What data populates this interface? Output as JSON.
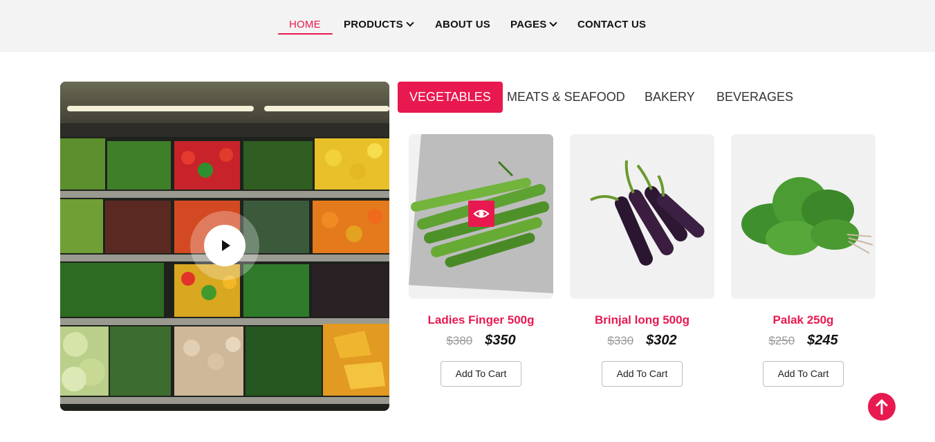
{
  "nav": {
    "items": [
      {
        "label": "HOME",
        "active": true
      },
      {
        "label": "PRODUCTS",
        "dropdown": true
      },
      {
        "label": "ABOUT US"
      },
      {
        "label": "PAGES",
        "dropdown": true
      },
      {
        "label": "CONTACT US"
      }
    ]
  },
  "video": {
    "icon": "play-icon"
  },
  "tabs": [
    {
      "label": "VEGETABLES",
      "active": true
    },
    {
      "label": "MEATS & SEAFOOD"
    },
    {
      "label": "BAKERY"
    },
    {
      "label": "BEVERAGES"
    }
  ],
  "products": [
    {
      "name": "Ladies Finger 500g",
      "old_price": "$380",
      "price": "$350",
      "cart_label": "Add To Cart",
      "image": "okra-image",
      "hovered": true
    },
    {
      "name": "Brinjal long 500g",
      "old_price": "$330",
      "price": "$302",
      "cart_label": "Add To Cart",
      "image": "eggplant-image"
    },
    {
      "name": "Palak 250g",
      "old_price": "$250",
      "price": "$245",
      "cart_label": "Add To Cart",
      "image": "spinach-image"
    }
  ],
  "colors": {
    "accent": "#e8194f",
    "nav_bg": "#f3f3f3",
    "card_bg": "#f1f1f1"
  },
  "scroll_top": {
    "icon": "arrow-up-icon"
  }
}
